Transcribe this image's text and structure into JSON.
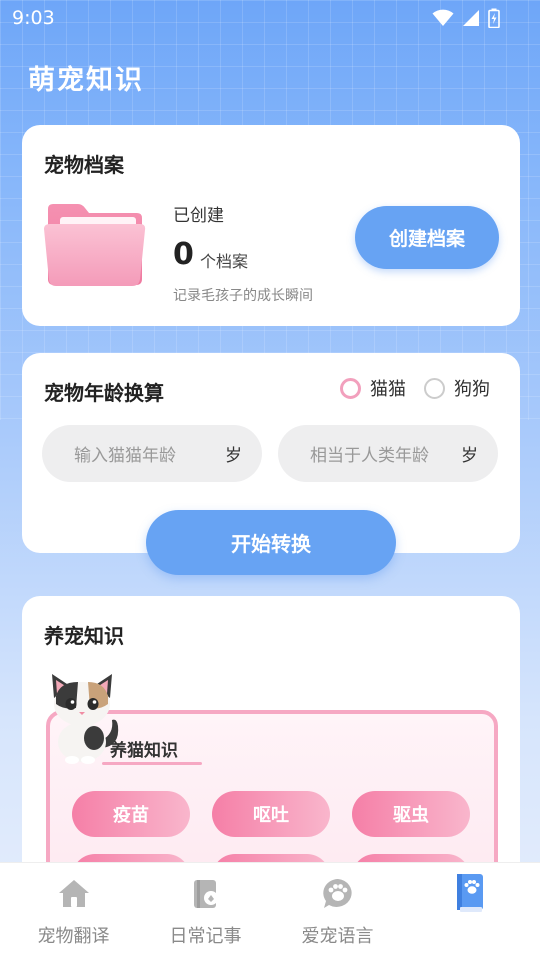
{
  "status_bar": {
    "time": "9:03"
  },
  "page": {
    "title": "萌宠知识"
  },
  "profile_card": {
    "title": "宠物档案",
    "created_label": "已创建",
    "count": "0",
    "count_unit": "个档案",
    "description": "记录毛孩子的成长瞬间",
    "create_button": "创建档案"
  },
  "age_card": {
    "title": "宠物年龄换算",
    "options": [
      {
        "label": "猫猫",
        "checked": true
      },
      {
        "label": "狗狗",
        "checked": false
      }
    ],
    "pet_age_placeholder": "输入猫猫年龄",
    "pet_age_unit": "岁",
    "human_age_placeholder": "相当于人类年龄",
    "human_age_unit": "岁",
    "convert_button": "开始转换"
  },
  "knowledge_card": {
    "title": "养宠知识",
    "section_label": "养猫知识",
    "tags": [
      "疫苗",
      "呕吐",
      "驱虫"
    ]
  },
  "bottom_nav": {
    "items": [
      {
        "label": "宠物翻译",
        "icon": "home-icon"
      },
      {
        "label": "日常记事",
        "icon": "notebook-icon"
      },
      {
        "label": "爱宠语言",
        "icon": "paw-chat-icon"
      },
      {
        "label": "",
        "icon": "paw-book-icon",
        "active": true
      }
    ]
  },
  "colors": {
    "primary_blue": "#67a3f3",
    "pink": "#f57fa7",
    "pink_border": "#f6a8c3"
  }
}
